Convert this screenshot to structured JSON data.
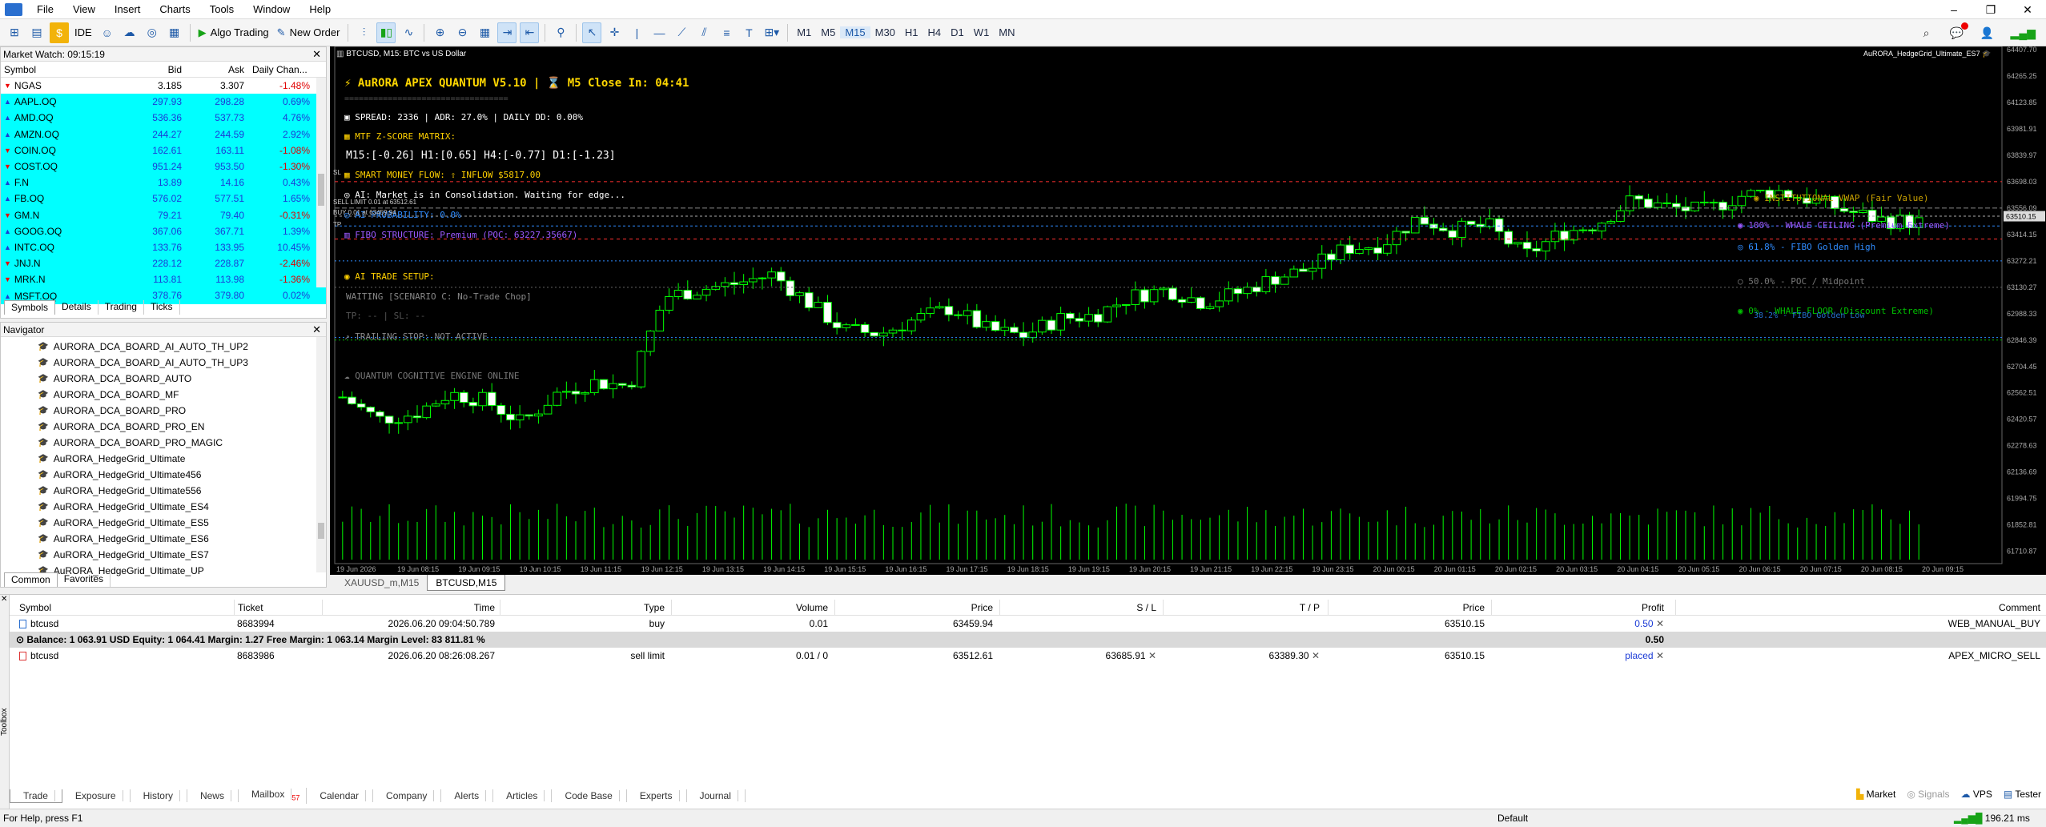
{
  "menu": [
    "File",
    "View",
    "Insert",
    "Charts",
    "Tools",
    "Window",
    "Help"
  ],
  "toolbar": {
    "ide": "IDE",
    "algo": "Algo Trading",
    "new_order": "New Order",
    "timeframes": [
      "M1",
      "M5",
      "M15",
      "M30",
      "H1",
      "H4",
      "D1",
      "W1",
      "MN"
    ],
    "active_tf": "M15"
  },
  "market_watch": {
    "title": "Market Watch: 09:15:19",
    "headers": {
      "symbol": "Symbol",
      "bid": "Bid",
      "ask": "Ask",
      "change": "Daily Chan..."
    },
    "rows": [
      {
        "symbol": "NGAS",
        "bid": "3.185",
        "ask": "3.307",
        "change": "-1.48%",
        "hl": false
      },
      {
        "symbol": "AAPL.OQ",
        "bid": "297.93",
        "ask": "298.28",
        "change": "0.69%",
        "hl": true
      },
      {
        "symbol": "AMD.OQ",
        "bid": "536.36",
        "ask": "537.73",
        "change": "4.76%",
        "hl": true
      },
      {
        "symbol": "AMZN.OQ",
        "bid": "244.27",
        "ask": "244.59",
        "change": "2.92%",
        "hl": true
      },
      {
        "symbol": "COIN.OQ",
        "bid": "162.61",
        "ask": "163.11",
        "change": "-1.08%",
        "hl": true
      },
      {
        "symbol": "COST.OQ",
        "bid": "951.24",
        "ask": "953.50",
        "change": "-1.30%",
        "hl": true
      },
      {
        "symbol": "F.N",
        "bid": "13.89",
        "ask": "14.16",
        "change": "0.43%",
        "hl": true
      },
      {
        "symbol": "FB.OQ",
        "bid": "576.02",
        "ask": "577.51",
        "change": "1.65%",
        "hl": true
      },
      {
        "symbol": "GM.N",
        "bid": "79.21",
        "ask": "79.40",
        "change": "-0.31%",
        "hl": true
      },
      {
        "symbol": "GOOG.OQ",
        "bid": "367.06",
        "ask": "367.71",
        "change": "1.39%",
        "hl": true
      },
      {
        "symbol": "INTC.OQ",
        "bid": "133.76",
        "ask": "133.95",
        "change": "10.45%",
        "hl": true
      },
      {
        "symbol": "JNJ.N",
        "bid": "228.12",
        "ask": "228.87",
        "change": "-2.46%",
        "hl": true
      },
      {
        "symbol": "MRK.N",
        "bid": "113.81",
        "ask": "113.98",
        "change": "-1.36%",
        "hl": true
      },
      {
        "symbol": "MSFT.OQ",
        "bid": "378.76",
        "ask": "379.80",
        "change": "0.02%",
        "hl": true
      }
    ],
    "tabs": [
      "Symbols",
      "Details",
      "Trading",
      "Ticks"
    ]
  },
  "navigator": {
    "title": "Navigator",
    "items": [
      "AURORA_DCA_BOARD_AI_AUTO_TH_UP2",
      "AURORA_DCA_BOARD_AI_AUTO_TH_UP3",
      "AURORA_DCA_BOARD_AUTO",
      "AURORA_DCA_BOARD_MF",
      "AURORA_DCA_BOARD_PRO",
      "AURORA_DCA_BOARD_PRO_EN",
      "AURORA_DCA_BOARD_PRO_MAGIC",
      "AuRORA_HedgeGrid_Ultimate",
      "AuRORA_HedgeGrid_Ultimate456",
      "AuRORA_HedgeGrid_Ultimate556",
      "AuRORA_HedgeGrid_Ultimate_ES4",
      "AuRORA_HedgeGrid_Ultimate_ES5",
      "AuRORA_HedgeGrid_Ultimate_ES6",
      "AuRORA_HedgeGrid_Ultimate_ES7",
      "AuRORA_HedgeGrid_Ultimate_UP"
    ],
    "tabs": [
      "Common",
      "Favorites"
    ]
  },
  "chart": {
    "title": "BTCUSD, M15: BTC vs US Dollar",
    "ea": "AuRORA_HedgeGrid_Ultimate_ES7",
    "overlay": {
      "head": "AuRORA APEX QUANTUM V5.10 | ⌛ M5 Close In: 04:41",
      "dashes": "==================================",
      "spread": "SPREAD: 2336  |  ADR: 27.0%  |  DAILY DD: 0.00%",
      "mtf": "MTF Z-SCORE MATRIX:",
      "z": "M15:[-0.26]  H1:[0.65]  H4:[-0.77]  D1:[-1.23]",
      "smart": "SMART MONEY FLOW:  ⇧ INFLOW $5817.00",
      "ai": "AI: Market is in Consolidation. Waiting for edge...",
      "prob": "AI PROBABILITY: 0.0%",
      "fibo": "FIBO STRUCTURE: Premium (POC: 63227.35667)",
      "setup": "AI TRADE SETUP:",
      "waiting": "WAITING [SCENARIO C: No-Trade Chop]",
      "tp": "TP: -- | SL: --",
      "trail": "TRAILING STOP: NOT ACTIVE",
      "engine": "QUANTUM COGNITIVE ENGINE ONLINE"
    },
    "levels": {
      "vwap": "INSTITUTIONAL VWAP (Fair Value)",
      "ceil": "100% - WHALE CEILING (Premium Extreme)",
      "golden": "61.8% - FIBO Golden High",
      "poc": "50.0% - POC / Midpoint",
      "floor": "0% - WHALE FLOOR (Discount Extreme)",
      "golden_low": "38.2% - FIBO Golden Low"
    },
    "trade_lines": {
      "sell": "SELL LIMIT 0.01 at 63512.61",
      "buy": "BUY 0.01 at 63459.94",
      "sl": "SL",
      "tp": "TP"
    },
    "price_labels": [
      "64407.70",
      "64265.25",
      "64123.85",
      "63981.91",
      "63839.97",
      "63698.03",
      "63556.09",
      "63414.15",
      "63272.21",
      "63130.27",
      "62988.33",
      "62846.39",
      "62704.45",
      "62562.51",
      "62420.57",
      "62278.63",
      "62136.69",
      "61994.75",
      "61852.81",
      "61710.87"
    ],
    "bid_tag": "63510.15",
    "time_labels": [
      "19 Jun 2026",
      "19 Jun 08:15",
      "19 Jun 09:15",
      "19 Jun 10:15",
      "19 Jun 11:15",
      "19 Jun 12:15",
      "19 Jun 13:15",
      "19 Jun 14:15",
      "19 Jun 15:15",
      "19 Jun 16:15",
      "19 Jun 17:15",
      "19 Jun 18:15",
      "19 Jun 19:15",
      "19 Jun 20:15",
      "19 Jun 21:15",
      "19 Jun 22:15",
      "19 Jun 23:15",
      "20 Jun 00:15",
      "20 Jun 01:15",
      "20 Jun 02:15",
      "20 Jun 03:15",
      "20 Jun 04:15",
      "20 Jun 05:15",
      "20 Jun 06:15",
      "20 Jun 07:15",
      "20 Jun 08:15",
      "20 Jun 09:15"
    ]
  },
  "chart_tabs": [
    "XAUUSD_m,M15",
    "BTCUSD,M15"
  ],
  "trade": {
    "headers": [
      "Symbol",
      "Ticket",
      "Time",
      "Type",
      "Volume",
      "Price",
      "S / L",
      "T / P",
      "Price",
      "Profit",
      "Comment"
    ],
    "rows": [
      [
        "btcusd",
        "8683994",
        "2026.06.20 09:04:50.789",
        "buy",
        "0.01",
        "63459.94",
        "",
        "",
        "63510.15",
        "0.50",
        "WEB_MANUAL_BUY"
      ],
      [
        "btcusd",
        "8683986",
        "2026.06.20 08:26:08.267",
        "sell limit",
        "0.01 / 0",
        "63512.61",
        "63685.91",
        "63389.30",
        "63510.15",
        "placed",
        "APEX_MICRO_SELL"
      ]
    ],
    "balance": "Balance: 1 063.91 USD  Equity: 1 064.41  Margin: 1.27  Free Margin: 1 063.14  Margin Level: 83 811.81 %",
    "balance_profit": "0.50",
    "tabs": [
      "Trade",
      "Exposure",
      "History",
      "News",
      "Mailbox",
      "Calendar",
      "Company",
      "Alerts",
      "Articles",
      "Code Base",
      "Experts",
      "Journal"
    ],
    "mailbox_count": "57",
    "strip": "Toolbox",
    "right": [
      "Market",
      "Signals",
      "VPS",
      "Tester"
    ]
  },
  "status": {
    "help": "For Help, press F1",
    "profile": "Default",
    "ping": "196.21 ms"
  },
  "colors": {
    "bull": "#00ff00",
    "bear": "#ffffff",
    "overlay_text": "#ffff00",
    "vwap": "#c8a000",
    "ceiling": "#9b59ff",
    "golden": "#2f8cff"
  }
}
